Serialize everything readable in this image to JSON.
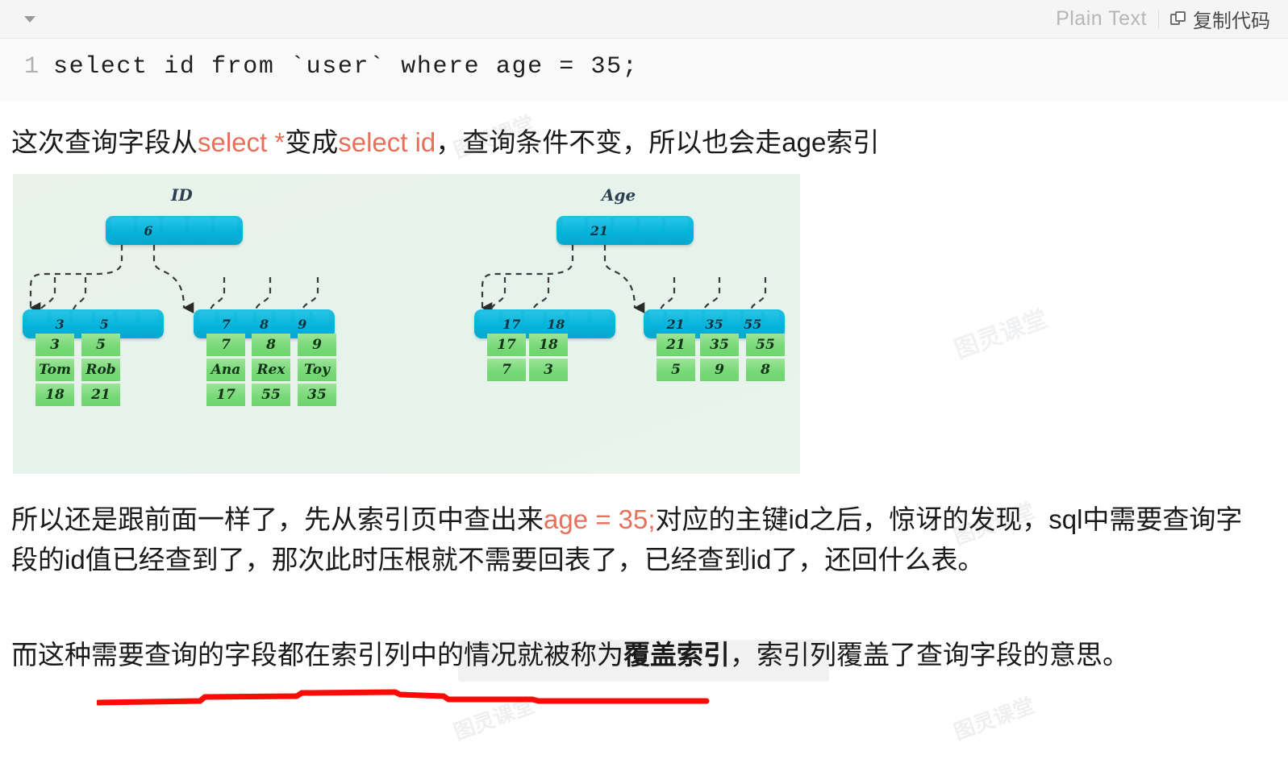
{
  "code_block": {
    "collapse_icon": "caret-down-icon",
    "language_label": "Plain Text",
    "copy_icon": "copy-icon",
    "copy_label": "复制代码",
    "line_number": "1",
    "code": "select id from `user` where age = 35;"
  },
  "paragraphs": {
    "p1": {
      "a": "这次查询字段从",
      "kw1": "select *",
      "b": "变成",
      "kw2": "select id",
      "c": "，查询条件不变，所以也会走age索引"
    },
    "p2": {
      "a": "所以还是跟前面一样了，先从索引页中查出来",
      "kw1": "age = 35;",
      "b": "对应的主键id之后，惊讶的发现，sql中需要查询字段的id值已经查到了，那次此时压根就不需要回表了，已经查到id了，还回什么表。"
    },
    "p3": {
      "a": "而这种需要查询的字段都在索引列中的情况就被称为",
      "bold": "覆盖索引",
      "b": "，索引列覆盖了查询字段的意思。"
    }
  },
  "figure": {
    "watermark": "图灵课堂",
    "id_tree": {
      "title": "ID",
      "root": [
        "",
        "6",
        "",
        "",
        ""
      ],
      "internal": [
        [
          "",
          "3",
          "",
          "5",
          "",
          ""
        ],
        [
          "",
          "7",
          "",
          "8",
          "",
          "9",
          ""
        ]
      ],
      "leaves": [
        {
          "id": "3",
          "name": "Tom",
          "age": "18"
        },
        {
          "id": "5",
          "name": "Rob",
          "age": "21"
        },
        {
          "id": "7",
          "name": "Ana",
          "age": "17"
        },
        {
          "id": "8",
          "name": "Rex",
          "age": "55"
        },
        {
          "id": "9",
          "name": "Toy",
          "age": "35"
        }
      ]
    },
    "age_tree": {
      "title": "Age",
      "root": [
        "",
        "21",
        "",
        "",
        ""
      ],
      "internal": [
        [
          "",
          "17",
          "",
          "18",
          "",
          ""
        ],
        [
          "",
          "21",
          "",
          "35",
          "",
          "55",
          ""
        ]
      ],
      "leaves": [
        {
          "age": "17",
          "id": "7"
        },
        {
          "age": "18",
          "id": "3"
        },
        {
          "age": "21",
          "id": "5"
        },
        {
          "age": "35",
          "id": "9"
        },
        {
          "age": "55",
          "id": "8"
        }
      ]
    }
  },
  "annotations": {
    "highlight_color": "#f1f1f1",
    "underline_color": "#fb0b05",
    "keyword_color": "#e8705a"
  }
}
